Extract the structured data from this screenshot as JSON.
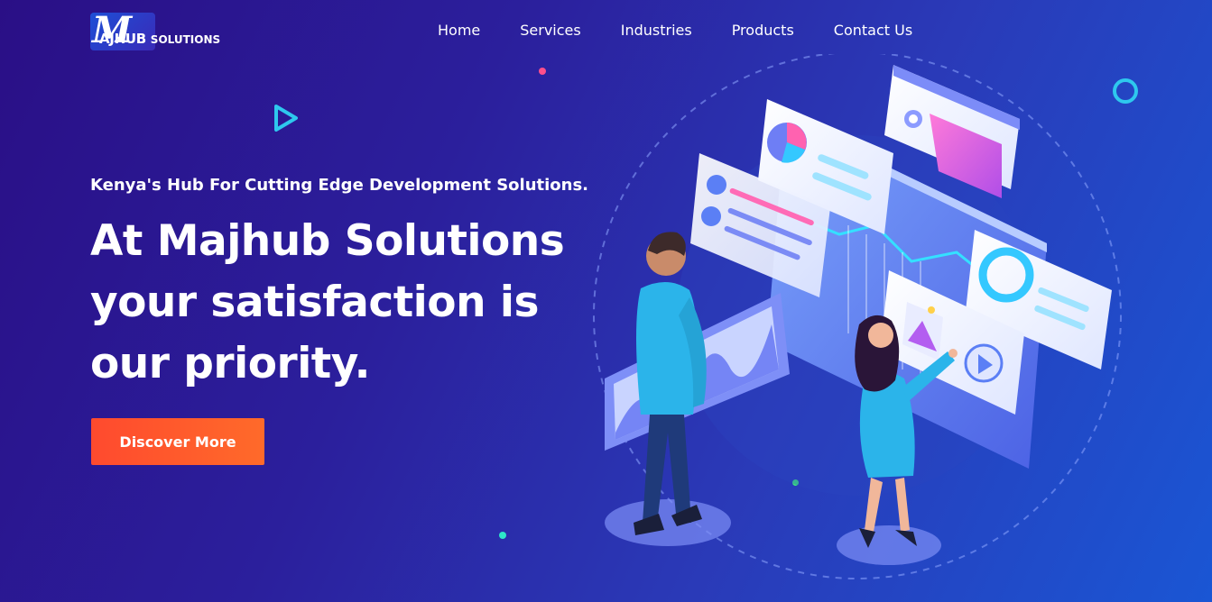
{
  "logo": {
    "mark": "M",
    "name": "AJHUB",
    "suffix": "SOLUTIONS"
  },
  "nav": {
    "items": [
      {
        "label": "Home"
      },
      {
        "label": "Services"
      },
      {
        "label": "Industries"
      },
      {
        "label": "Products"
      },
      {
        "label": "Contact Us"
      }
    ]
  },
  "hero": {
    "tagline": "Kenya's Hub For Cutting Edge Development Solutions.",
    "headline": "At Majhub Solutions your satisfaction is our priority.",
    "cta_label": "Discover More"
  },
  "colors": {
    "accent": "#ff5a2c",
    "background_start": "#2a0f86",
    "background_end": "#1a56d4"
  },
  "icons": {
    "play": "play-triangle-icon",
    "ring": "ring-icon"
  }
}
